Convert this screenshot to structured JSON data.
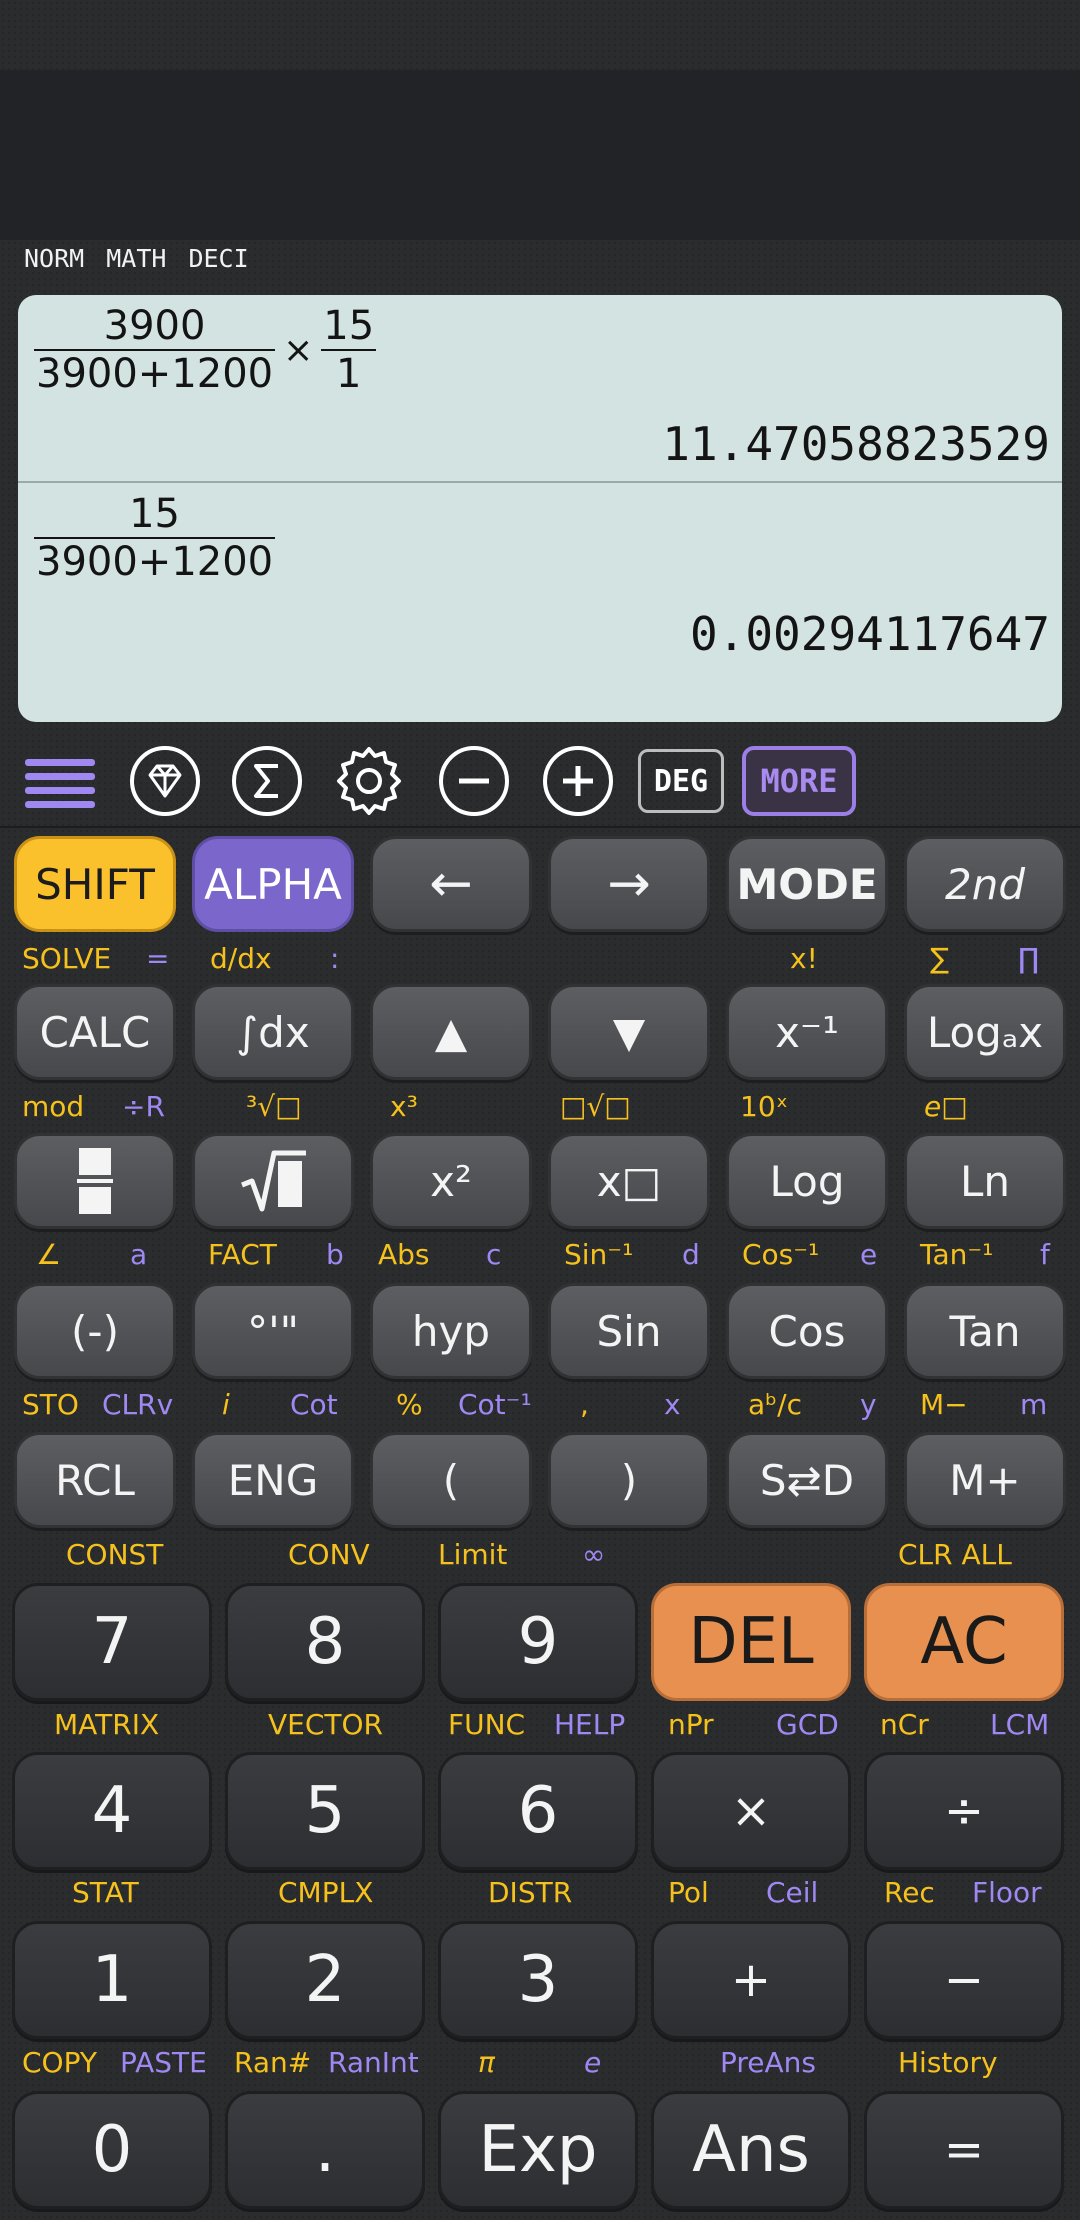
{
  "status": [
    "NORM",
    "MATH",
    "DECI"
  ],
  "history": [
    {
      "frac1_num": "3900",
      "frac1_den": "3900+1200",
      "times": "×",
      "frac2_num": "15",
      "frac2_den": "1",
      "result": "11.47058823529"
    },
    {
      "frac1_num": "15",
      "frac1_den": "3900+1200",
      "result": "0.00294117647"
    }
  ],
  "toolbar": {
    "deg": "DEG",
    "more": "MORE",
    "icons": [
      "menu-icon",
      "gem-icon",
      "sigma-icon",
      "gear-icon",
      "minus-circle-icon",
      "plus-circle-icon"
    ]
  },
  "keys": {
    "r1": [
      "SHIFT",
      "ALPHA",
      "←",
      "→",
      "MODE",
      "2nd"
    ],
    "r2": [
      "CALC",
      "∫dx",
      "▲",
      "▼",
      "x⁻¹",
      "Logₐx"
    ],
    "r3": [
      "",
      "",
      "x²",
      "x□",
      "Log",
      "Ln"
    ],
    "r4": [
      "(-)",
      "°'\"",
      "hyp",
      "Sin",
      "Cos",
      "Tan"
    ],
    "r5": [
      "RCL",
      "ENG",
      "(",
      ")",
      "S⇄D",
      "M+"
    ],
    "r6": [
      "7",
      "8",
      "9",
      "DEL",
      "AC"
    ],
    "r7": [
      "4",
      "5",
      "6",
      "×",
      "÷"
    ],
    "r8": [
      "1",
      "2",
      "3",
      "+",
      "−"
    ],
    "r9": [
      "0",
      ".",
      "Exp",
      "Ans",
      "="
    ]
  },
  "labels": {
    "r1": [
      "SOLVE",
      "=",
      "d/dx",
      ":",
      "x!",
      "∑",
      "∏"
    ],
    "r2": [
      "mod",
      "÷R",
      "³√□",
      "x³",
      "□√□",
      "10ˣ",
      "e□"
    ],
    "r3": [
      "∠",
      "a",
      "FACT",
      "b",
      "Abs",
      "c",
      "Sin⁻¹",
      "d",
      "Cos⁻¹",
      "e",
      "Tan⁻¹",
      "f"
    ],
    "r4": [
      "STO",
      "CLRv",
      "i",
      "Cot",
      "%",
      "Cot⁻¹",
      ",",
      "x",
      "aᵇ/c",
      "y",
      "M−",
      "m"
    ],
    "r5": [
      "CONST",
      "CONV",
      "Limit",
      "∞",
      "CLR ALL"
    ],
    "r6": [
      "MATRIX",
      "VECTOR",
      "FUNC",
      "HELP",
      "nPr",
      "GCD",
      "nCr",
      "LCM"
    ],
    "r7": [
      "STAT",
      "CMPLX",
      "DISTR",
      "Pol",
      "Ceil",
      "Rec",
      "Floor"
    ],
    "r8": [
      "COPY",
      "PASTE",
      "Ran#",
      "RanInt",
      "π",
      "e",
      "PreAns",
      "History"
    ]
  },
  "colors": {
    "shift": "#fbc12d",
    "alpha": "#7b67cc",
    "del_ac": "#e8904f",
    "label_yellow": "#f5c11d",
    "label_purple": "#9f88f2",
    "screen": "#d2e3e2"
  }
}
